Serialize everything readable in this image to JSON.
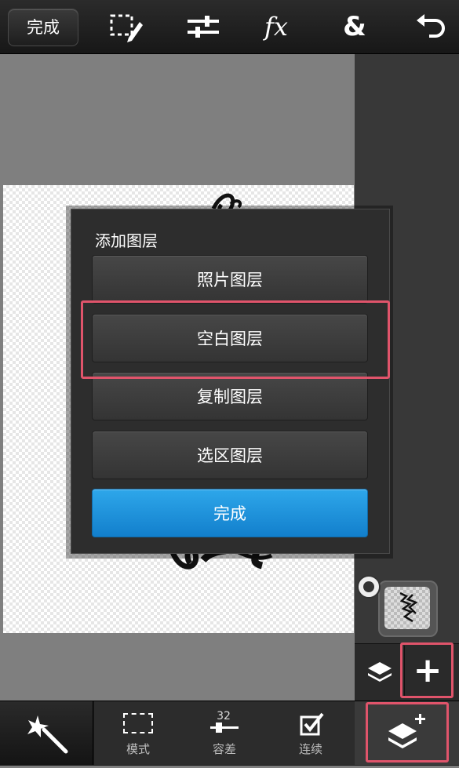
{
  "toolbar": {
    "done_label": "完成",
    "icons": [
      "selection-edit-icon",
      "adjustments-icon",
      "fx-icon",
      "blend-icon",
      "undo-icon"
    ],
    "fx_label": "fx",
    "blend_label": "&"
  },
  "dialog": {
    "title": "添加图层",
    "buttons": {
      "photo_layer": "照片图层",
      "blank_layer": "空白图层",
      "duplicate_layer": "复制图层",
      "selection_layer": "选区图层",
      "done": "完成"
    }
  },
  "bottom_toolbar": {
    "mode_label": "模式",
    "tolerance_label": "容差",
    "tolerance_value": "32",
    "contiguous_label": "连续"
  },
  "right_panel": {
    "add_label": "+"
  },
  "colors": {
    "accent_blue": "#1e90dd",
    "highlight": "#e0546b",
    "toolbar_bg": "#1a1a1a"
  }
}
